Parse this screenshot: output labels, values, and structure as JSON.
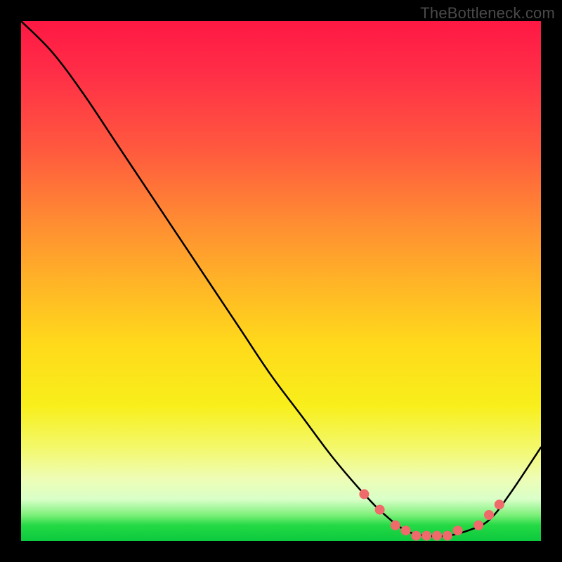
{
  "watermark": "TheBottleneck.com",
  "colors": {
    "line": "#000000",
    "marker_fill": "#ef6a6a",
    "marker_stroke": "#ef6a6a"
  },
  "chart_data": {
    "type": "line",
    "title": "",
    "xlabel": "",
    "ylabel": "",
    "xlim": [
      0,
      100
    ],
    "ylim": [
      0,
      100
    ],
    "grid": false,
    "legend": false,
    "series": [
      {
        "name": "curve",
        "x": [
          0,
          6,
          12,
          18,
          24,
          30,
          36,
          42,
          48,
          54,
          60,
          66,
          70,
          74,
          78,
          82,
          86,
          90,
          94,
          100
        ],
        "y": [
          100,
          94,
          86,
          77,
          68,
          59,
          50,
          41,
          32,
          24,
          16,
          9,
          5,
          2,
          1,
          1,
          2,
          4,
          9,
          18
        ]
      }
    ],
    "markers": {
      "name": "flat-region",
      "x": [
        66,
        69,
        72,
        74,
        76,
        78,
        80,
        82,
        84,
        88,
        90,
        92
      ],
      "y": [
        9,
        6,
        3,
        2,
        1,
        1,
        1,
        1,
        2,
        3,
        5,
        7
      ]
    }
  }
}
